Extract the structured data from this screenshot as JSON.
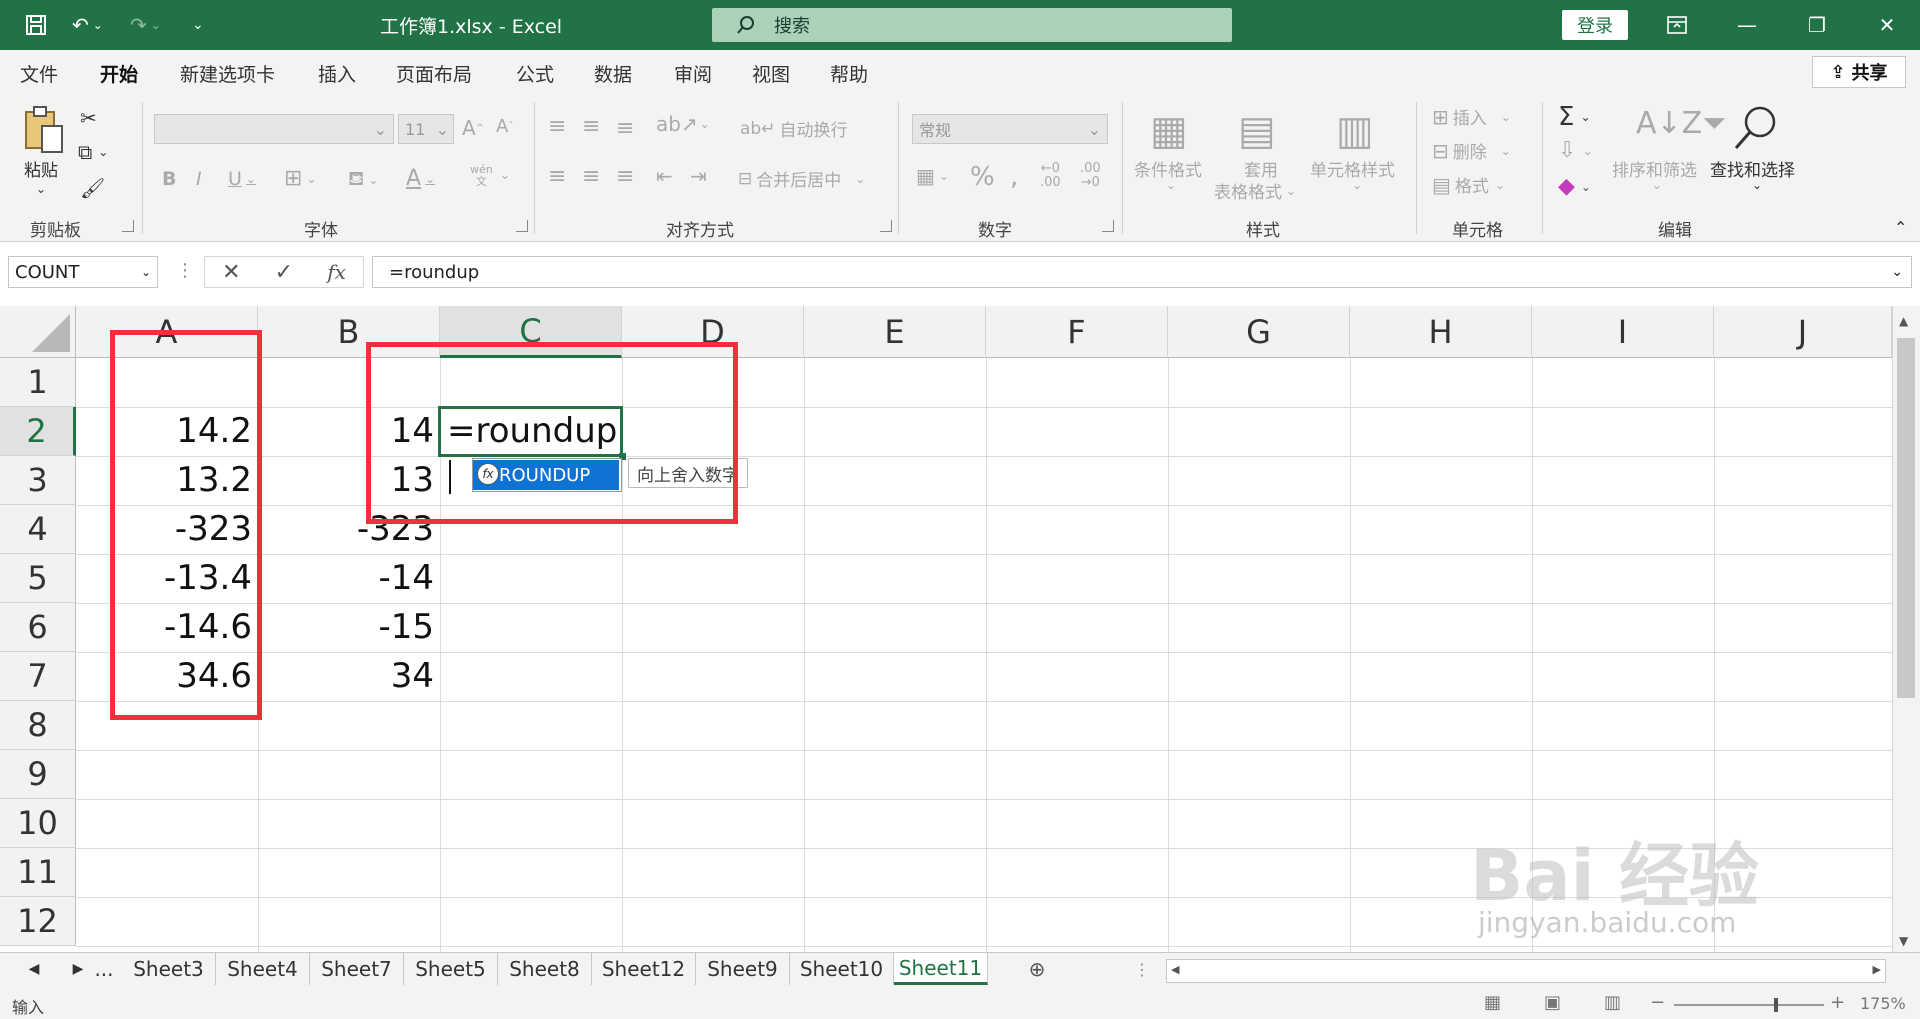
{
  "titlebar": {
    "title": "工作簿1.xlsx  -  Excel",
    "search_placeholder": "搜索",
    "login_label": "登录"
  },
  "menu": {
    "tabs": [
      "文件",
      "开始",
      "新建选项卡",
      "插入",
      "页面布局",
      "公式",
      "数据",
      "审阅",
      "视图",
      "帮助"
    ],
    "active_tab": "开始",
    "share_label": "共享"
  },
  "ribbon": {
    "clipboard": {
      "paste_label": "粘贴",
      "group_label": "剪贴板"
    },
    "font": {
      "size_value": "11",
      "group_label": "字体",
      "phonetic_label": "wén"
    },
    "align": {
      "wrap_label": "自动换行",
      "merge_label": "合并后居中",
      "group_label": "对齐方式"
    },
    "number": {
      "format_value": "常规",
      "group_label": "数字"
    },
    "styles": {
      "cond_label": "条件格式",
      "table_label_1": "套用",
      "table_label_2": "表格格式",
      "cell_style_label": "单元格样式",
      "group_label": "样式"
    },
    "cells": {
      "insert_label": "插入",
      "delete_label": "删除",
      "format_label": "格式",
      "group_label": "单元格"
    },
    "editing": {
      "sort_label": "排序和筛选",
      "find_label": "查找和选择",
      "group_label": "编辑"
    }
  },
  "formula_bar": {
    "name_box": "COUNT",
    "formula": "=roundup",
    "fx_label": "fx"
  },
  "grid": {
    "columns": [
      "A",
      "B",
      "C",
      "D",
      "E",
      "F",
      "G",
      "H",
      "I",
      "J"
    ],
    "selected_column": "C",
    "rows": [
      "1",
      "2",
      "3",
      "4",
      "5",
      "6",
      "7",
      "8",
      "9",
      "10",
      "11",
      "12"
    ],
    "selected_row": "2",
    "col_a": [
      "",
      "14.2",
      "13.2",
      "-323",
      "-13.4",
      "-14.6",
      "34.6"
    ],
    "col_b": [
      "",
      "14",
      "13",
      "-323",
      "-14",
      "-15",
      "34"
    ],
    "active_cell_text": "=roundup",
    "autocomplete": {
      "item": "ROUNDUP",
      "tooltip": "向上舍入数字",
      "badge": "fx"
    }
  },
  "sheets": {
    "tabs": [
      "Sheet3",
      "Sheet4",
      "Sheet7",
      "Sheet5",
      "Sheet8",
      "Sheet12",
      "Sheet9",
      "Sheet10",
      "Sheet11"
    ],
    "active": "Sheet11",
    "overflow": "..."
  },
  "status": {
    "mode": "输入",
    "zoom": "175%"
  },
  "watermark": {
    "line1": "Bai 经验",
    "line2": "jingyan.baidu.com"
  },
  "colors": {
    "excel_green": "#217346",
    "highlight_red": "#f0303a",
    "autocomplete_blue": "#0f73d4"
  }
}
